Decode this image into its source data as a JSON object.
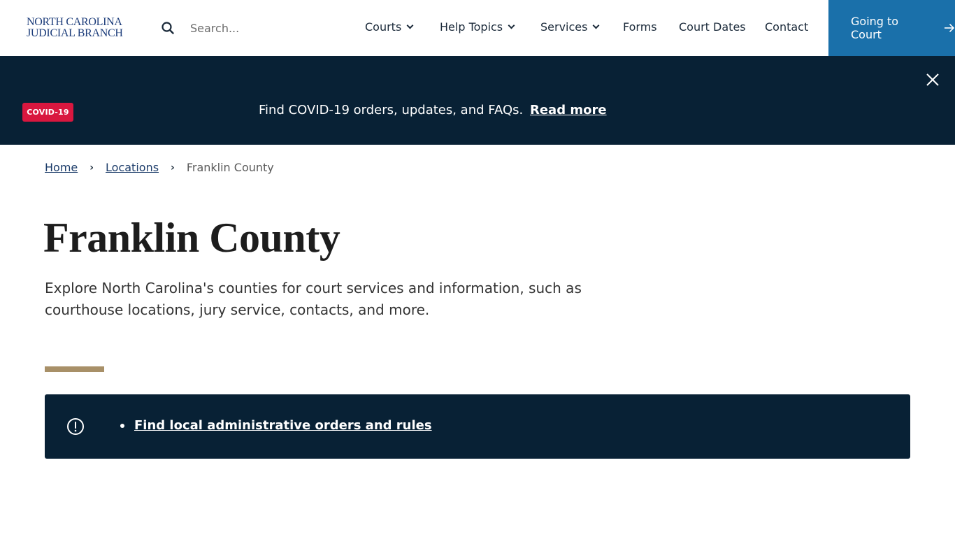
{
  "header": {
    "logo_line1": "NORTH CAROLINA",
    "logo_line2": "JUDICIAL BRANCH",
    "search_placeholder": "Search...",
    "nav": [
      {
        "label": "Courts",
        "has_dropdown": true
      },
      {
        "label": "Help Topics",
        "has_dropdown": true
      },
      {
        "label": "Services",
        "has_dropdown": true
      },
      {
        "label": "Forms",
        "has_dropdown": false
      },
      {
        "label": "Court Dates",
        "has_dropdown": false
      },
      {
        "label": "Contact",
        "has_dropdown": false
      }
    ],
    "cta_label": "Going to Court",
    "cta_icon": "arrow-right-icon"
  },
  "banner": {
    "badge": "COVID-19",
    "text": "Find COVID-19 orders, updates, and FAQs.",
    "link_label": "Read more",
    "close_icon": "close-icon"
  },
  "breadcrumb": {
    "items": [
      {
        "label": "Home",
        "link": true
      },
      {
        "label": "Locations",
        "link": true
      },
      {
        "label": "Franklin County",
        "link": false
      }
    ],
    "separator_icon": "chevron-right-icon"
  },
  "page": {
    "title": "Franklin County",
    "intro": "Explore North Carolina's counties for court services and information, such as courthouse locations, jury service, contacts, and more."
  },
  "notice": {
    "icon": "alert-circle-icon",
    "items": [
      {
        "label": "Find local administrative orders and rules"
      }
    ]
  },
  "colors": {
    "brand_navy": "#082135",
    "cta_blue": "#1a70aa",
    "badge_red": "#d9173f",
    "accent_gold": "#a89068",
    "logo_blue": "#1c3c7a"
  }
}
